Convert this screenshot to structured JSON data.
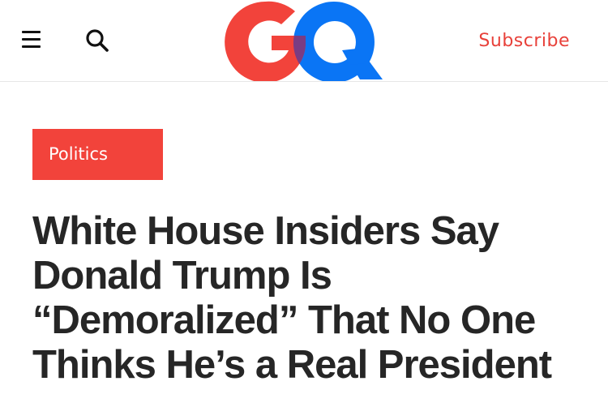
{
  "header": {
    "menu_icon": "hamburger-menu-icon",
    "search_icon": "search-icon",
    "logo_text": "GQ",
    "subscribe_label": "Subscribe"
  },
  "colors": {
    "logo_g": "#f2433b",
    "logo_q": "#0a75f5",
    "logo_overlap": "#7a3c83",
    "accent": "#e8413a",
    "category_bg": "#f2433b",
    "headline_text": "#262626"
  },
  "article": {
    "category": "Politics",
    "headline_lines": [
      "White House Insiders Say",
      "Donald Trump Is",
      "“Demoralized” That No One",
      "Thinks He’s a Real President"
    ]
  }
}
